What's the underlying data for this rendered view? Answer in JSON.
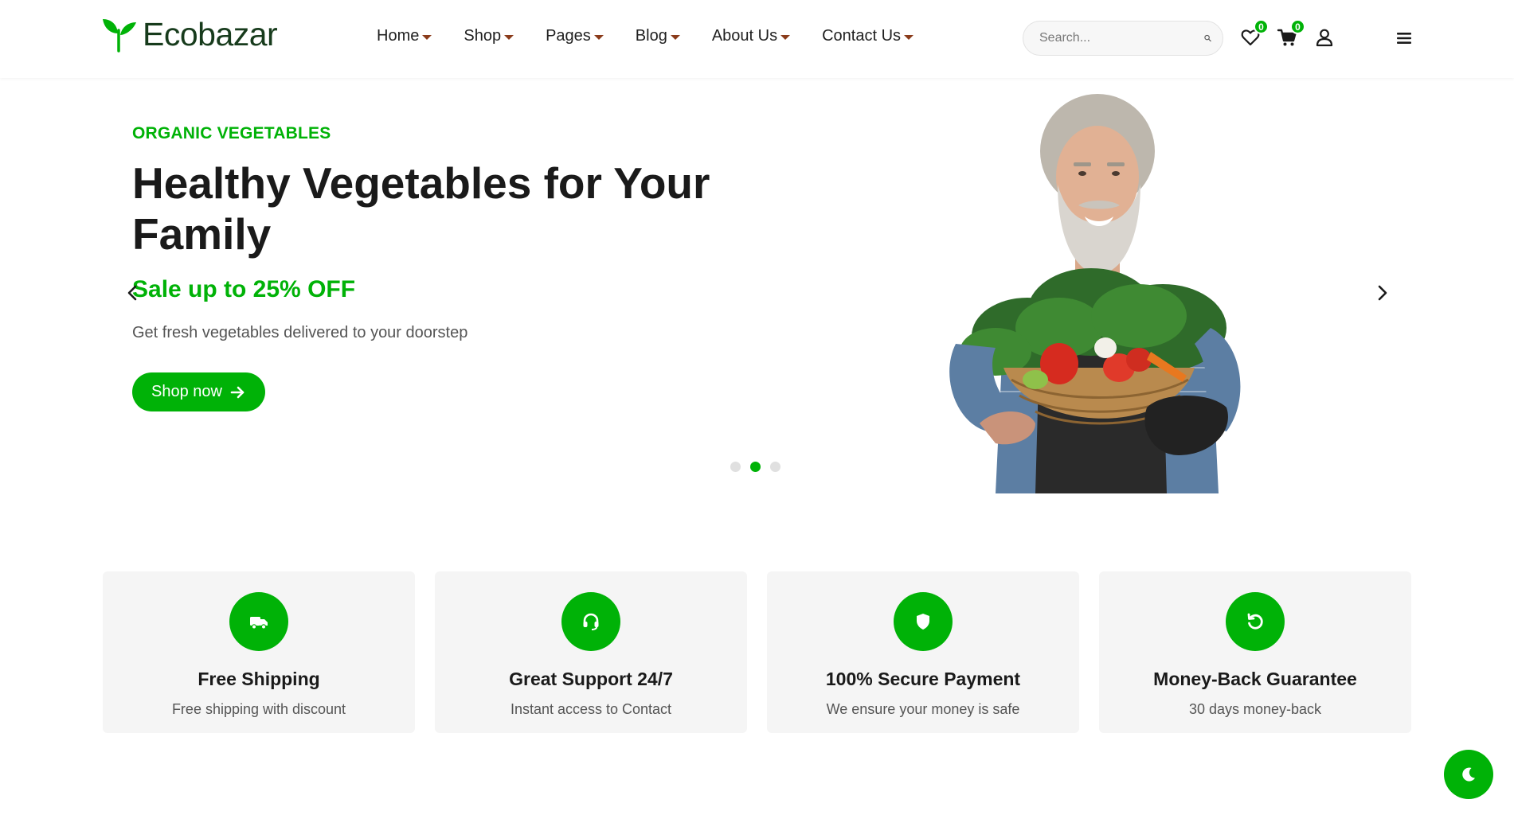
{
  "brand": {
    "name": "Ecobazar",
    "accent": "#00b207"
  },
  "nav": {
    "items": [
      {
        "label": "Home"
      },
      {
        "label": "Shop"
      },
      {
        "label": "Pages"
      },
      {
        "label": "Blog"
      },
      {
        "label": "About Us"
      },
      {
        "label": "Contact Us"
      }
    ]
  },
  "search": {
    "placeholder": "Search...",
    "value": ""
  },
  "header_icons": {
    "wishlist_count": "0",
    "cart_count": "0",
    "icons": [
      "heart-icon",
      "cart-icon",
      "user-icon",
      "menu-icon"
    ]
  },
  "hero": {
    "eyebrow": "ORGANIC VEGETABLES",
    "title": "Healthy Vegetables for Your Family",
    "sale": "Sale up to 25% OFF",
    "description": "Get fresh vegetables delivered to your doorstep",
    "cta_label": "Shop now",
    "slides_total": 3,
    "active_slide": 2
  },
  "features": [
    {
      "icon": "truck-icon",
      "title": "Free Shipping",
      "subtitle": "Free shipping with discount"
    },
    {
      "icon": "headset-icon",
      "title": "Great Support 24/7",
      "subtitle": "Instant access to Contact"
    },
    {
      "icon": "shield-icon",
      "title": "100% Secure Payment",
      "subtitle": "We ensure your money is safe"
    },
    {
      "icon": "refresh-icon",
      "title": "Money-Back Guarantee",
      "subtitle": "30 days money-back"
    }
  ],
  "theme_toggle": {
    "icon": "moon-icon"
  }
}
